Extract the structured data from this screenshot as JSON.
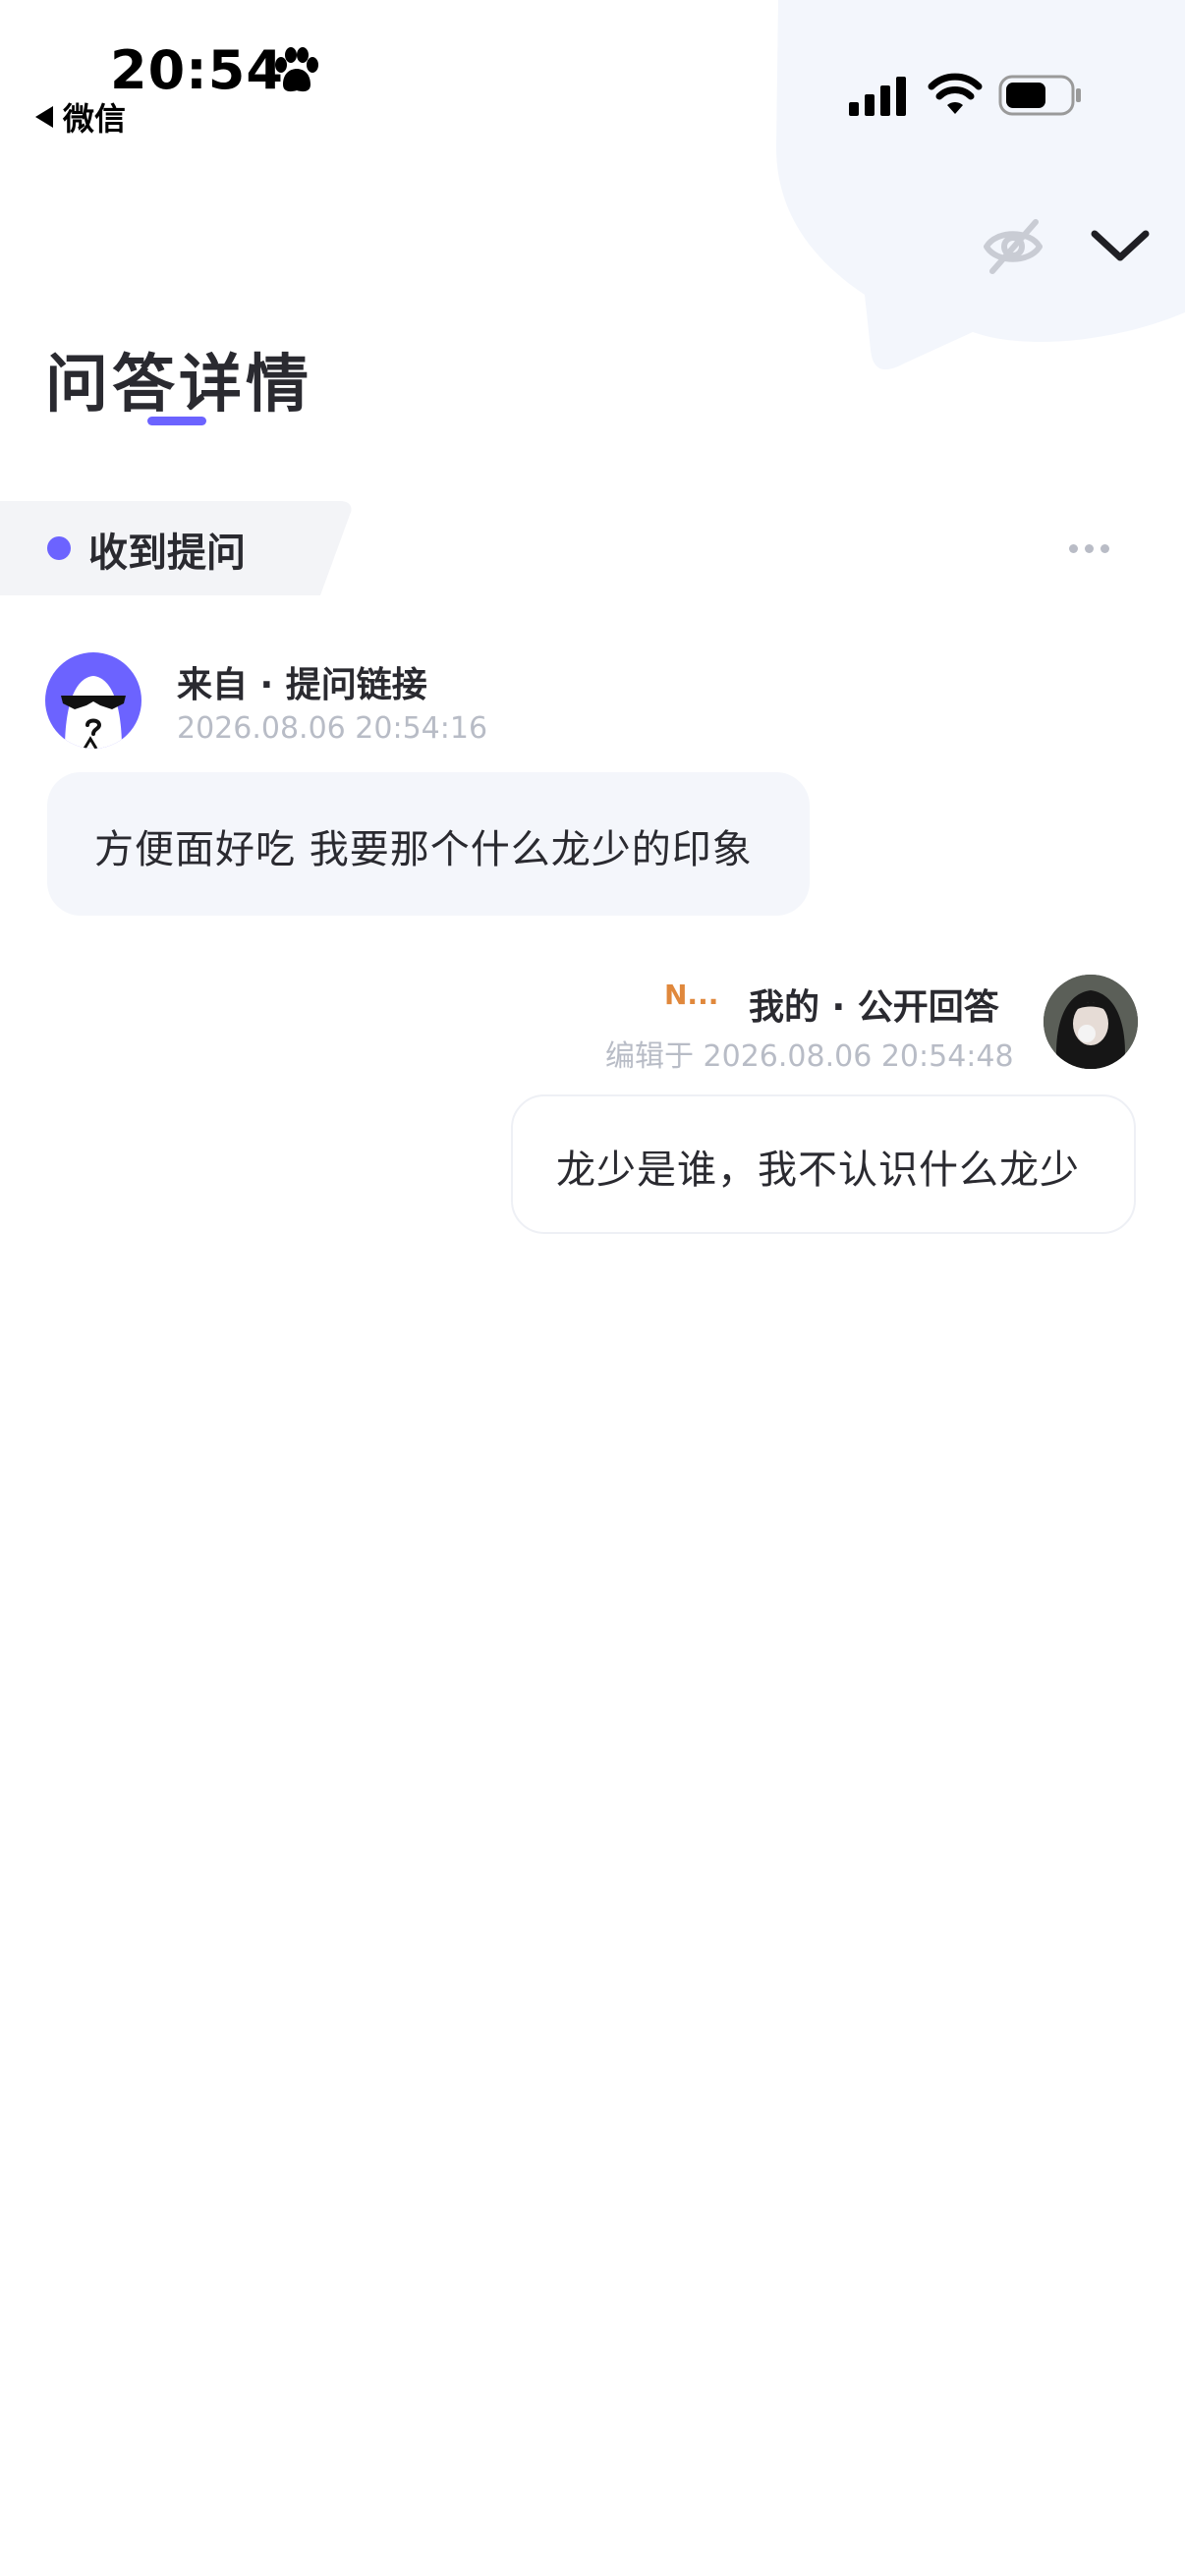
{
  "status_bar": {
    "time": "20:54",
    "back_app": "微信"
  },
  "header": {
    "page_title": "问答详情"
  },
  "section": {
    "label": "收到提问"
  },
  "question": {
    "source": "来自 · 提问链接",
    "timestamp": "2026.08.06 20:54:16",
    "text": "方便面好吃 我要那个什么龙少的印象"
  },
  "answer": {
    "badge": "N...",
    "source": "我的 · 公开回答",
    "timestamp": "编辑于 2026.08.06 20:54:48",
    "text": "龙少是谁，我不认识什么龙少"
  },
  "colors": {
    "accent": "#6c63ff",
    "muted_text": "#b8bcc6",
    "bubble_bg": "#f4f6fb",
    "badge": "#e0883c"
  },
  "icons": {
    "paw": "paw-icon",
    "back": "back-arrow-icon",
    "signal": "signal-icon",
    "wifi": "wifi-icon",
    "battery": "battery-icon",
    "hidden": "eye-off-icon",
    "collapse": "chevron-down-icon",
    "more": "more-dots-icon"
  }
}
